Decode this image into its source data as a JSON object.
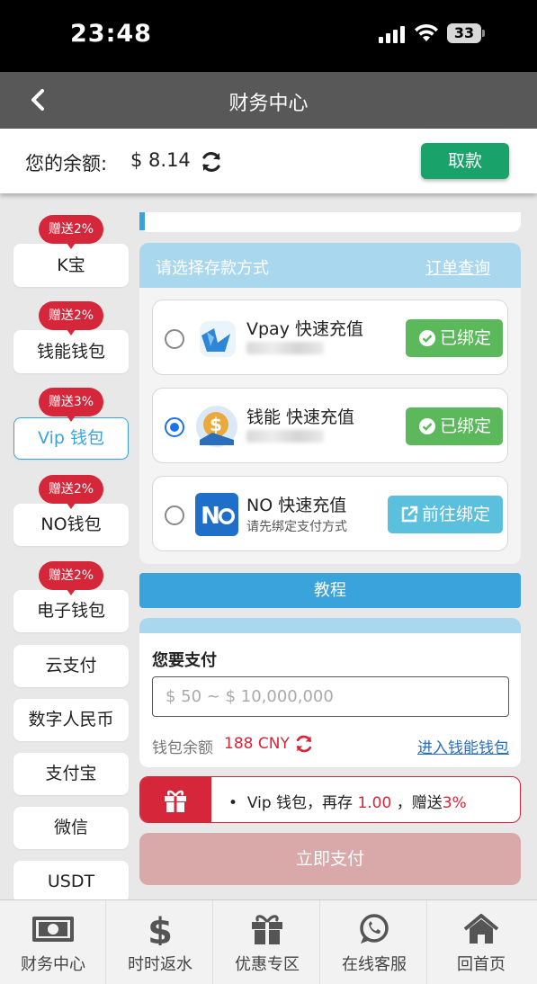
{
  "status": {
    "time": "23:48",
    "battery": "33"
  },
  "header": {
    "title": "财务中心"
  },
  "balance": {
    "label": "您的余额:",
    "amount": "$ 8.14",
    "withdraw_label": "取款"
  },
  "menu": [
    {
      "label": "K宝",
      "promo": "赠送2%"
    },
    {
      "label": "钱能钱包",
      "promo": "赠送2%"
    },
    {
      "label": "Vip 钱包",
      "promo": "赠送3%",
      "active": true
    },
    {
      "label": "NO钱包",
      "promo": "赠送2%"
    },
    {
      "label": "电子钱包",
      "promo": "赠送2%"
    },
    {
      "label": "云支付"
    },
    {
      "label": "数字人民币"
    },
    {
      "label": "支付宝"
    },
    {
      "label": "微信"
    },
    {
      "label": "USDT"
    }
  ],
  "deposit": {
    "header_label": "请选择存款方式",
    "order_link": "订单查询",
    "options": [
      {
        "name": "Vpay 快速充值",
        "button": "已绑定",
        "selected": false
      },
      {
        "name": "钱能 快速充值",
        "button": "已绑定",
        "selected": true
      },
      {
        "name": "NO 快速充值",
        "subtitle": "请先绑定支付方式",
        "button": "前往绑定",
        "selected": false
      }
    ]
  },
  "tutorial_label": "教程",
  "payment": {
    "label": "您要支付",
    "placeholder": "$ 50 ~ $ 10,000,000",
    "wallet_label": "钱包余额",
    "wallet_amount": "188 CNY",
    "wallet_link": "进入钱能钱包"
  },
  "bonus": {
    "bullet": "•",
    "prefix": "Vip 钱包，再存",
    "amount": "1.00",
    "middle": "，赠送",
    "percent": "3%"
  },
  "pay_now_label": "立即支付",
  "tabs": [
    {
      "label": "财务中心",
      "icon": "cash-icon"
    },
    {
      "label": "时时返水",
      "icon": "dollar-icon"
    },
    {
      "label": "优惠专区",
      "icon": "gift-icon"
    },
    {
      "label": "在线客服",
      "icon": "whatsapp-icon"
    },
    {
      "label": "回首页",
      "icon": "home-icon"
    }
  ],
  "colors": {
    "accent": "#3aa3db",
    "promo": "#d6263a",
    "withdraw": "#1aa26b",
    "bound": "#5bb85b",
    "bind": "#5bc0de"
  }
}
